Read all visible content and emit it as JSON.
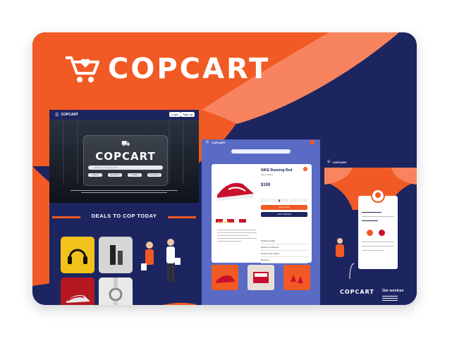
{
  "brand": {
    "name": "COPCART"
  },
  "home": {
    "nav_logo": "COPCART",
    "login": "Login",
    "signup": "Sign up",
    "hero_name": "COPCART",
    "search_placeholder": "What are you looking for?",
    "chips": [
      "Fashion",
      "Electronics",
      "Clothing",
      "Accessories"
    ],
    "deals_title": "DEALS TO COP TODAY"
  },
  "product": {
    "nav_logo": "COPCART",
    "title": "NIKE Running Red",
    "subtitle": "Men's Shoes",
    "price": "$100",
    "add_to_cart": "Add to Cart",
    "wishlist": "Add to Wishlist",
    "rows": [
      "Product Details",
      "Delivery & Returns",
      "Product Information",
      "Reviews"
    ]
  },
  "profile": {
    "nav_logo": "COPCART",
    "footer_name": "COPCART",
    "footer_services": "Our services"
  },
  "colors": {
    "orange": "#f15a24",
    "salmon": "#f7845f",
    "navy": "#1c2560",
    "periwinkle": "#5a6bc5"
  }
}
